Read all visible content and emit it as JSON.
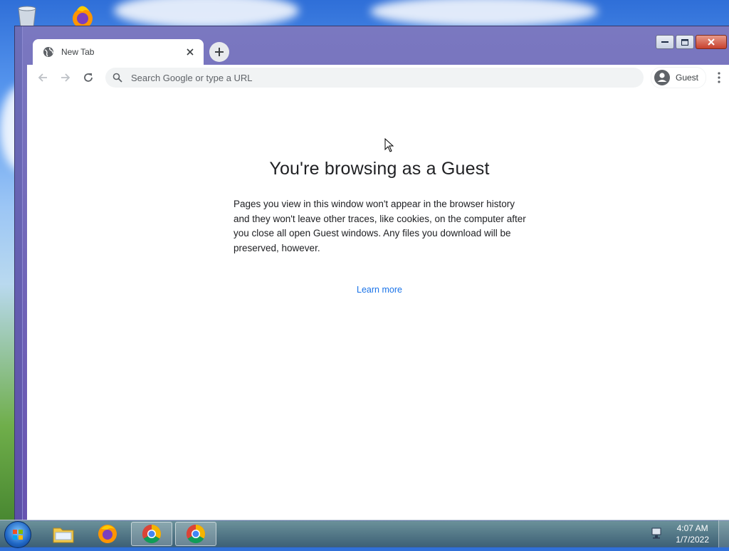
{
  "browser": {
    "tab": {
      "title": "New Tab"
    },
    "omnibox": {
      "placeholder": "Search Google or type a URL"
    },
    "profile": {
      "label": "Guest"
    }
  },
  "page": {
    "heading": "You're browsing as a Guest",
    "description": "Pages you view in this window won't appear in the browser history and they won't leave other traces, like cookies, on the computer after you close all open Guest windows. Any files you download will be preserved, however.",
    "learn_more": "Learn more"
  },
  "taskbar": {
    "time": "4:07 AM",
    "date": "1/7/2022",
    "items": [
      "start-menu",
      "file-explorer",
      "firefox",
      "chrome",
      "chrome"
    ]
  },
  "desktop": {
    "icons": [
      "recycle-bin",
      "firefox"
    ]
  },
  "colors": {
    "link": "#1a73e8",
    "window_frame": "#6753b0",
    "omnibox_bg": "#f1f3f4"
  }
}
